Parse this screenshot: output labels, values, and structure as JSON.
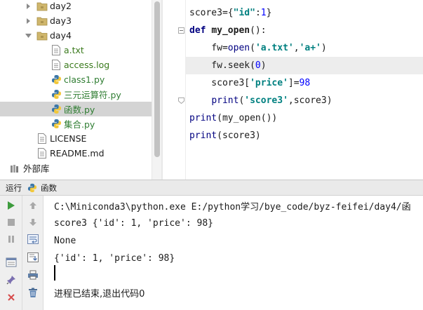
{
  "project_tree": {
    "items": [
      {
        "label": "day2",
        "type": "folder",
        "expanded": false
      },
      {
        "label": "day3",
        "type": "folder",
        "expanded": false
      },
      {
        "label": "day4",
        "type": "folder",
        "expanded": true
      },
      {
        "label": "a.txt",
        "type": "text-file"
      },
      {
        "label": "access.log",
        "type": "text-file"
      },
      {
        "label": "class1.py",
        "type": "python-file"
      },
      {
        "label": "三元运算符.py",
        "type": "python-file"
      },
      {
        "label": "函数.py",
        "type": "python-file",
        "selected": true
      },
      {
        "label": "集合.py",
        "type": "python-file"
      },
      {
        "label": "LICENSE",
        "type": "text-file"
      },
      {
        "label": "README.md",
        "type": "text-file"
      },
      {
        "label": "外部库",
        "type": "library",
        "partially_visible": true
      }
    ]
  },
  "editor": {
    "lines": [
      [
        {
          "t": "score3={",
          "c": "pl"
        },
        {
          "t": "\"id\"",
          "c": "str"
        },
        {
          "t": ":",
          "c": "pl"
        },
        {
          "t": "1",
          "c": "num"
        },
        {
          "t": "}",
          "c": "pl"
        }
      ],
      [
        {
          "t": "def ",
          "c": "kw"
        },
        {
          "t": "my_open",
          "c": "defname"
        },
        {
          "t": "():",
          "c": "pl"
        }
      ],
      [
        {
          "t": "    fw=",
          "c": "pl"
        },
        {
          "t": "open",
          "c": "bfn"
        },
        {
          "t": "(",
          "c": "pl"
        },
        {
          "t": "'a.txt'",
          "c": "str"
        },
        {
          "t": ",",
          "c": "pl"
        },
        {
          "t": "'a+'",
          "c": "str"
        },
        {
          "t": ")",
          "c": "pl"
        }
      ],
      [
        {
          "t": "    fw.seek(",
          "c": "pl"
        },
        {
          "t": "0",
          "c": "num"
        },
        {
          "t": ")",
          "c": "pl"
        }
      ],
      [
        {
          "t": "    score3[",
          "c": "pl"
        },
        {
          "t": "'price'",
          "c": "str"
        },
        {
          "t": "]=",
          "c": "pl"
        },
        {
          "t": "98",
          "c": "num"
        }
      ],
      [
        {
          "t": "    ",
          "c": "pl"
        },
        {
          "t": "print",
          "c": "bfn"
        },
        {
          "t": "(",
          "c": "pl"
        },
        {
          "t": "'score3'",
          "c": "str"
        },
        {
          "t": ",score3)",
          "c": "pl"
        }
      ],
      [
        {
          "t": "print",
          "c": "bfn"
        },
        {
          "t": "(my_open())",
          "c": "pl"
        }
      ],
      [
        {
          "t": "print",
          "c": "bfn"
        },
        {
          "t": "(score3)",
          "c": "pl"
        }
      ]
    ],
    "highlighted_line": 4
  },
  "run_panel": {
    "tab_label": "运行",
    "config_name": "函数",
    "console_lines": [
      "C:\\Miniconda3\\python.exe E:/python学习/bye_code/byz-feifei/day4/函",
      "score3 {'id': 1, 'price': 98}",
      "None",
      "{'id': 1, 'price': 98}",
      "",
      "进程已结束,退出代码0"
    ]
  },
  "colors": {
    "keyword": "#000080",
    "string": "#008080",
    "number": "#0000ff",
    "selection": "#d4d4d4",
    "run_green": "#3e9c3e",
    "stop_red": "#d64b4b"
  },
  "icons": {
    "run": "play-icon",
    "stop": "stop-icon",
    "pause": "pause-icon",
    "rerun": "rerun-icon",
    "pin": "pin-icon",
    "close": "close-icon",
    "scroll_up": "arrow-up-icon",
    "scroll_down": "arrow-down-icon",
    "soft_wrap": "soft-wrap-icon",
    "scroll_end": "scroll-to-end-icon",
    "print": "print-icon",
    "clear": "trash-icon"
  }
}
